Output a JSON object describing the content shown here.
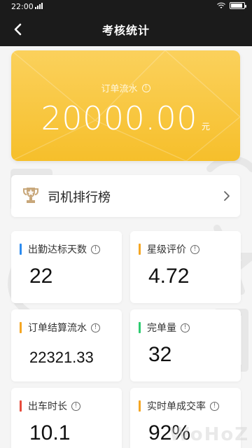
{
  "status_bar": {
    "time": "22:00"
  },
  "header": {
    "title": "考核统计",
    "back_icon": "chevron-left-icon"
  },
  "summary": {
    "label": "订单流水",
    "amount": "20000.00",
    "unit": "元",
    "accent_color": "#F7C33A"
  },
  "ranking": {
    "label": "司机排行榜",
    "icon": "trophy-icon"
  },
  "stats": [
    {
      "label": "出勤达标天数",
      "value": "22",
      "bar_color": "#2D8CF0"
    },
    {
      "label": "星级评价",
      "value": "4.72",
      "bar_color": "#F5A623"
    },
    {
      "label": "订单结算流水",
      "value": "22321.33",
      "bar_color": "#F5A623"
    },
    {
      "label": "完单量",
      "value": "32",
      "bar_color": "#2ECC71"
    },
    {
      "label": "出车时长",
      "value": "10.1",
      "bar_color": "#E74C3C"
    },
    {
      "label": "实时单成交率",
      "value": "92%",
      "bar_color": "#F5A623"
    }
  ],
  "watermark": {
    "text": "WoHoZ"
  }
}
